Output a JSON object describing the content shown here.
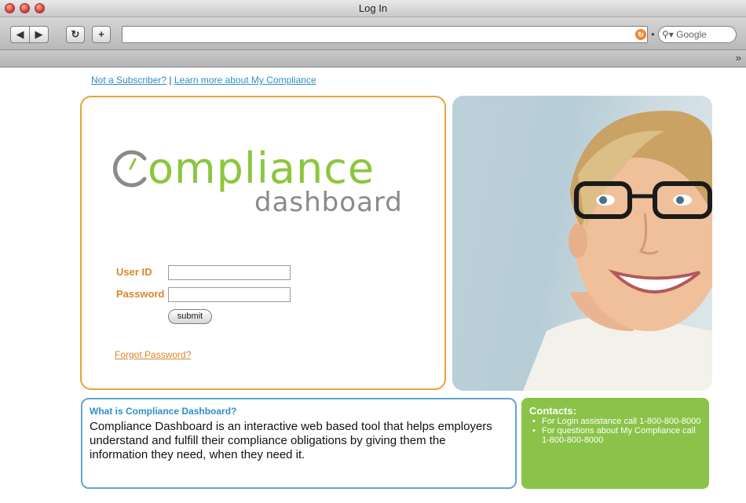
{
  "window": {
    "title": "Log In"
  },
  "toolbar": {
    "back_icon": "back-arrow-icon",
    "forward_icon": "forward-arrow-icon",
    "reload_icon": "reload-icon",
    "add_icon": "add-bookmark-icon",
    "url": "",
    "search_placeholder": "Google",
    "overflow_icon": "chevron-double-right-icon"
  },
  "page": {
    "links": {
      "not_subscriber": "Not a Subscriber?",
      "separator": "|",
      "learn_more": "Learn more about My Compliance"
    },
    "logo": {
      "main": "ompliance",
      "sub": "dashboard"
    },
    "login": {
      "user_label": "User ID",
      "password_label": "Password",
      "user_value": "",
      "password_value": "",
      "submit_label": "submit",
      "forgot_label": "Forgot Password?"
    },
    "what": {
      "title": "What is Compliance Dashboard?",
      "body": "Compliance Dashboard is an interactive web based tool that helps employers understand and fulfill their compliance obligations by giving them the information they need, when they need it."
    },
    "contacts": {
      "title": "Contacts:",
      "items": [
        "For Login assistance call 1-800-800-8000",
        "For questions about My Compliance call 1-800-800-8000"
      ]
    }
  },
  "colors": {
    "accent_orange": "#e8a33d",
    "accent_blue": "#2f8fc9",
    "accent_green": "#8bc34a"
  }
}
